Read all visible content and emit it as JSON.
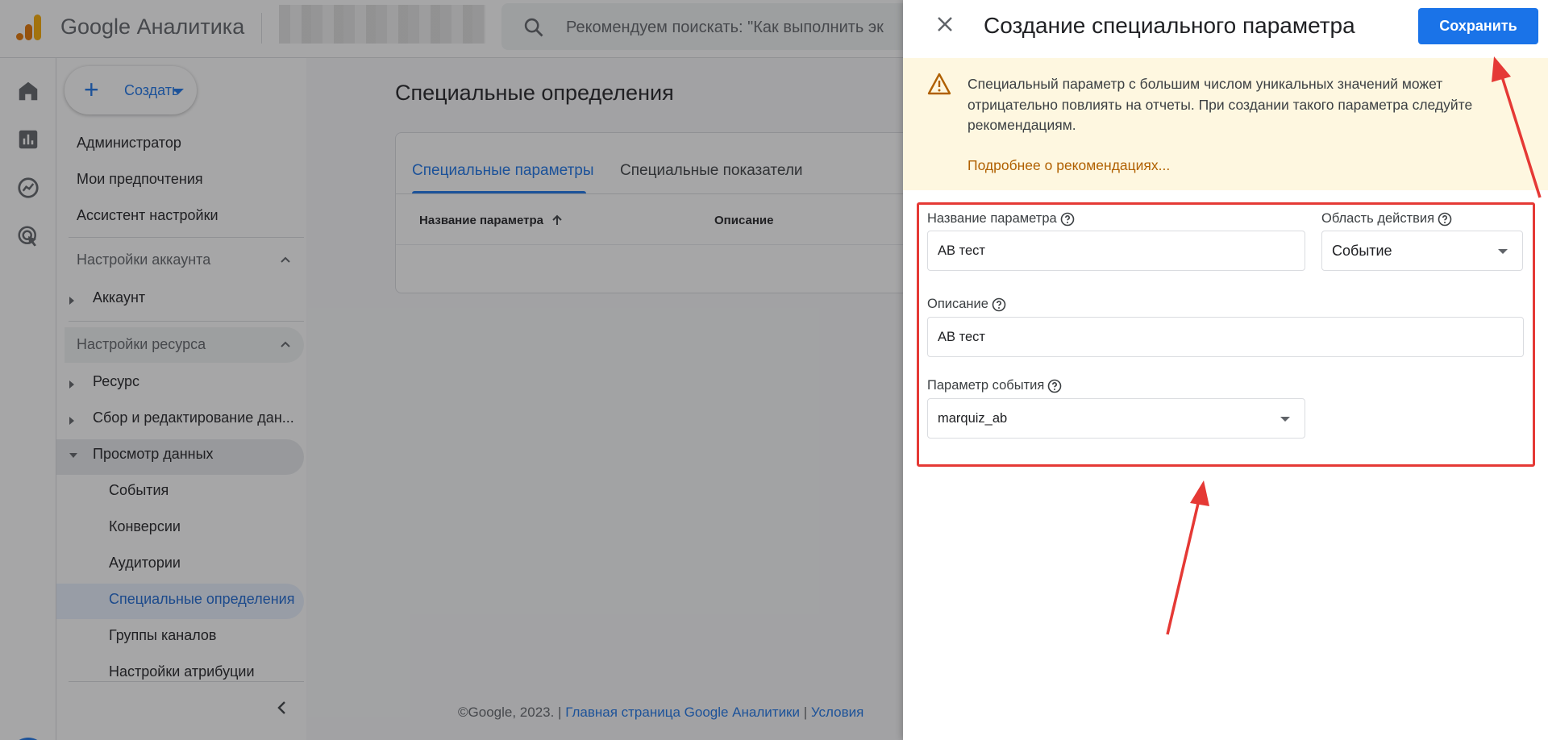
{
  "header": {
    "product_name": "Google Аналитика",
    "search_placeholder": "Рекомендуем поискать: \"Как выполнить эк"
  },
  "nav": {
    "create_label": "Создать",
    "top_items": [
      "Администратор",
      "Мои предпочтения",
      "Ассистент настройки"
    ],
    "account_section": "Настройки аккаунта",
    "account_item": "Аккаунт",
    "resource_section": "Настройки ресурса",
    "resource_items": [
      "Ресурс",
      "Сбор и редактирование дан...",
      "Просмотр данных"
    ],
    "sub_items": [
      "События",
      "Конверсии",
      "Аудитории",
      "Специальные определения",
      "Группы каналов",
      "Настройки атрибуции"
    ]
  },
  "main": {
    "page_title": "Специальные определения",
    "tabs": [
      "Специальные параметры",
      "Специальные показатели"
    ],
    "columns": [
      "Название параметра",
      "Описание"
    ],
    "footer_prefix": "©Google, 2023. |",
    "footer_link1": "Главная страница Google Аналитики",
    "footer_sep": "|",
    "footer_link2": "Условия"
  },
  "panel": {
    "title": "Создание специального параметра",
    "save_label": "Сохранить",
    "warning_text": "Специальный параметр с большим числом уникальных значений может отрицательно повлиять на отчеты. При создании такого параметра следуйте рекомендациям.",
    "warning_link": "Подробнее о рекомендациях...",
    "name_label": "Название параметра",
    "name_value": "AB тест",
    "scope_label": "Область действия",
    "scope_value": "Событие",
    "description_label": "Описание",
    "description_value": "AB тест",
    "event_param_label": "Параметр события",
    "event_param_value": "marquiz_ab"
  },
  "colors": {
    "accent": "#1a73e8",
    "annotation": "#e53935",
    "warning_bg": "#fef7e0",
    "warning_link": "#b06000"
  }
}
